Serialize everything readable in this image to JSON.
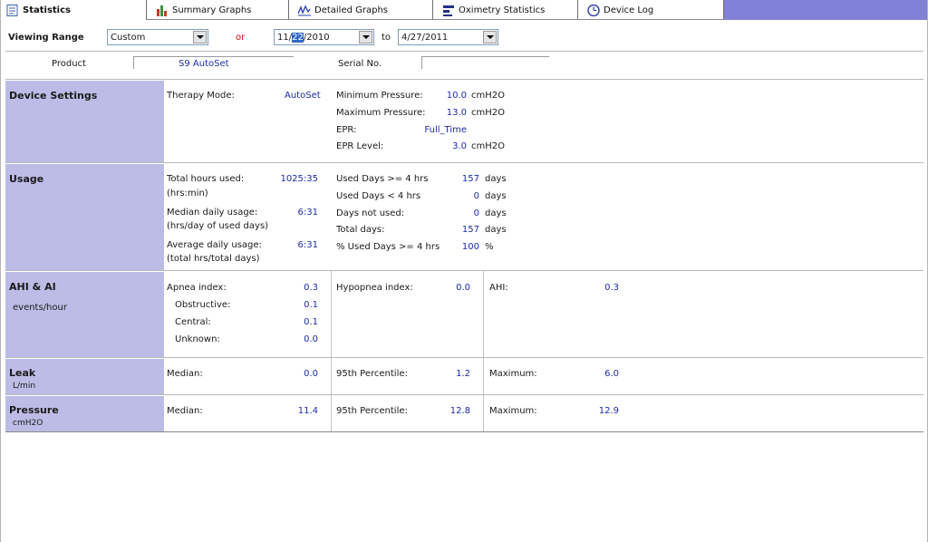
{
  "tabs": [
    {
      "label": "Statistics",
      "icon": "statistics-icon"
    },
    {
      "label": "Summary Graphs",
      "icon": "bar-chart-icon"
    },
    {
      "label": "Detailed Graphs",
      "icon": "line-graph-icon"
    },
    {
      "label": "Oximetry Statistics",
      "icon": "oximetry-icon"
    },
    {
      "label": "Device Log",
      "icon": "device-log-icon"
    }
  ],
  "range": {
    "label": "Viewing Range",
    "preset": "Custom",
    "or_label": "or",
    "from_prefix": "11/",
    "from_selected": "22",
    "from_suffix": "/2010",
    "to_label": "to",
    "to_date": "4/27/2011"
  },
  "product": {
    "product_label": "Product",
    "product_value": "S9 AutoSet",
    "serial_label": "Serial No.",
    "serial_value": ""
  },
  "device_settings": {
    "title": "Device Settings",
    "therapy_mode_label": "Therapy Mode:",
    "therapy_mode_value": "AutoSet",
    "min_pressure_label": "Minimum Pressure:",
    "min_pressure_value": "10.0",
    "min_pressure_unit": "cmH2O",
    "max_pressure_label": "Maximum Pressure:",
    "max_pressure_value": "13.0",
    "max_pressure_unit": "cmH2O",
    "epr_label": "EPR:",
    "epr_value": "Full_Time",
    "epr_level_label": "EPR Level:",
    "epr_level_value": "3.0",
    "epr_level_unit": "cmH2O"
  },
  "usage": {
    "title": "Usage",
    "total_hours_label": "Total hours used:",
    "total_hours_sub": "(hrs:min)",
    "total_hours_value": "1025:35",
    "median_label": "Median daily usage:",
    "median_sub": "(hrs/day of used days)",
    "median_value": "6:31",
    "average_label": "Average daily usage:",
    "average_sub": "(total hrs/total days)",
    "average_value": "6:31",
    "days_ge4_label": "Used Days >= 4 hrs",
    "days_ge4_value": "157",
    "days_lt4_label": "Used Days < 4 hrs",
    "days_lt4_value": "0",
    "not_used_label": "Days not used:",
    "not_used_value": "0",
    "total_days_label": "Total days:",
    "total_days_value": "157",
    "pct_label": "% Used Days >= 4 hrs",
    "pct_value": "100",
    "days_unit": "days",
    "pct_unit": "%"
  },
  "ahi": {
    "title": "AHI & AI",
    "subtitle": "events/hour",
    "apnea_label": "Apnea index:",
    "apnea_value": "0.3",
    "obstructive_label": "Obstructive:",
    "obstructive_value": "0.1",
    "central_label": "Central:",
    "central_value": "0.1",
    "unknown_label": "Unknown:",
    "unknown_value": "0.0",
    "hypopnea_label": "Hypopnea index:",
    "hypopnea_value": "0.0",
    "ahi_label": "AHI:",
    "ahi_value": "0.3"
  },
  "leak": {
    "title": "Leak",
    "subtitle": "L/min",
    "median_label": "Median:",
    "median_value": "0.0",
    "p95_label": "95th Percentile:",
    "p95_value": "1.2",
    "max_label": "Maximum:",
    "max_value": "6.0"
  },
  "pressure": {
    "title": "Pressure",
    "subtitle": "cmH2O",
    "median_label": "Median:",
    "median_value": "11.4",
    "p95_label": "95th Percentile:",
    "p95_value": "12.8",
    "max_label": "Maximum:",
    "max_value": "12.9"
  },
  "colors": {
    "section_header": "#bcbce6",
    "tab_fill": "#8181d7",
    "value_text": "#1c2ba8"
  }
}
